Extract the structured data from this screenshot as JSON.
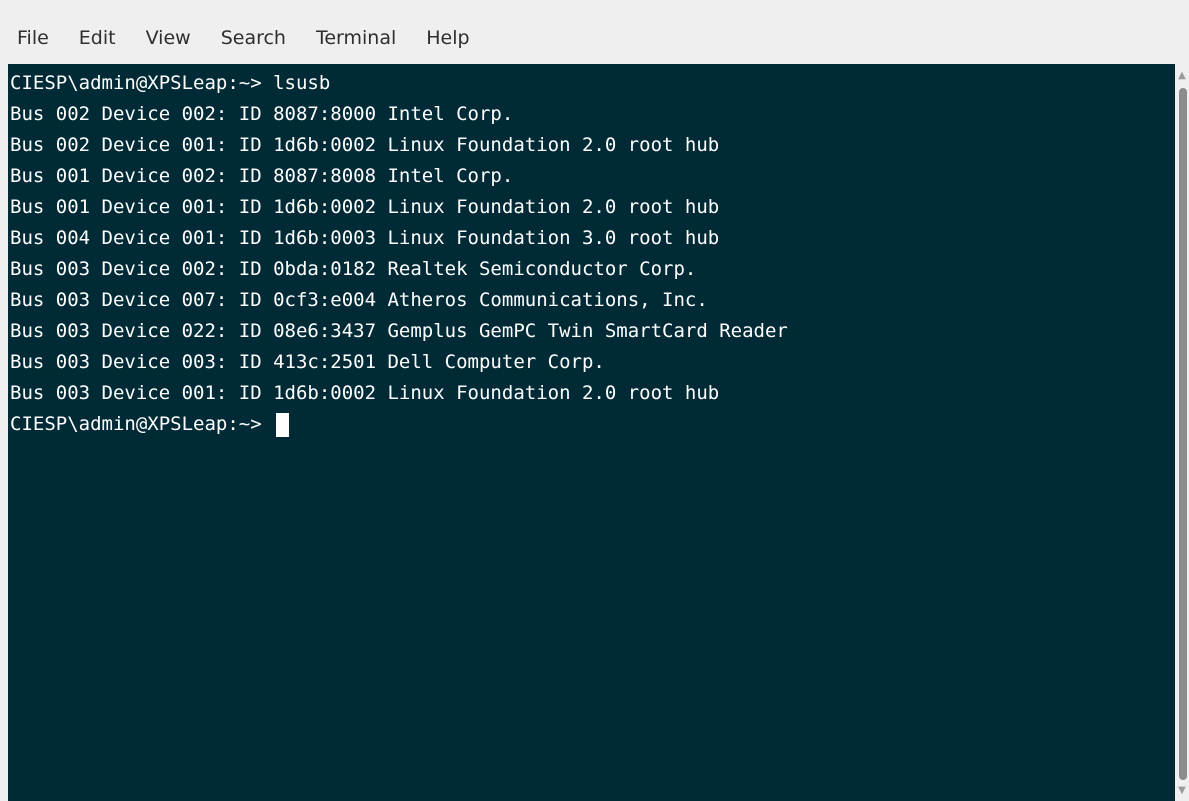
{
  "menubar": {
    "items": [
      {
        "label": "File"
      },
      {
        "label": "Edit"
      },
      {
        "label": "View"
      },
      {
        "label": "Search"
      },
      {
        "label": "Terminal"
      },
      {
        "label": "Help"
      }
    ]
  },
  "terminal": {
    "lines": [
      "CIESP\\admin@XPSLeap:~> lsusb",
      "Bus 002 Device 002: ID 8087:8000 Intel Corp.",
      "Bus 002 Device 001: ID 1d6b:0002 Linux Foundation 2.0 root hub",
      "Bus 001 Device 002: ID 8087:8008 Intel Corp.",
      "Bus 001 Device 001: ID 1d6b:0002 Linux Foundation 2.0 root hub",
      "Bus 004 Device 001: ID 1d6b:0003 Linux Foundation 3.0 root hub",
      "Bus 003 Device 002: ID 0bda:0182 Realtek Semiconductor Corp.",
      "Bus 003 Device 007: ID 0cf3:e004 Atheros Communications, Inc.",
      "Bus 003 Device 022: ID 08e6:3437 Gemplus GemPC Twin SmartCard Reader",
      "Bus 003 Device 003: ID 413c:2501 Dell Computer Corp.",
      "Bus 003 Device 001: ID 1d6b:0002 Linux Foundation 2.0 root hub"
    ],
    "prompt": "CIESP\\admin@XPSLeap:~> "
  },
  "colors": {
    "terminal_bg": "#002b36",
    "terminal_fg": "#ffffff",
    "menubar_bg": "#efefef"
  },
  "icons": {
    "scroll_up": "chevron-up-icon",
    "scroll_down": "chevron-down-icon"
  }
}
